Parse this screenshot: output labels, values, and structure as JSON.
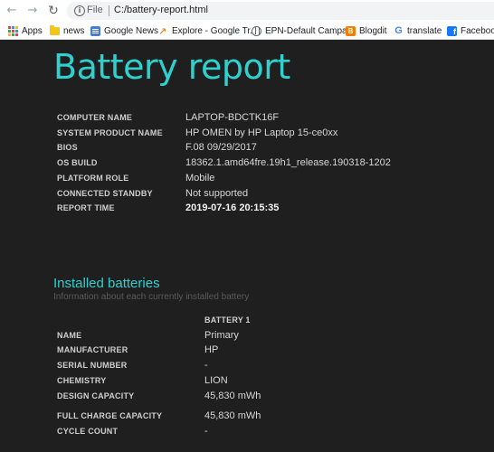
{
  "browser": {
    "nav": {
      "back": "←",
      "forward": "→",
      "reload": "↻"
    },
    "omnibox": {
      "info": "i",
      "scheme": "File",
      "url": "C:/battery-report.html"
    },
    "bookmarks": [
      "Apps",
      "news",
      "Google News",
      "Explore - Google Tr...",
      "EPN-Default Campa...",
      "Blogdit",
      "translate",
      "Facebook"
    ],
    "bookmark_icons": [
      "apps-icon",
      "folder-icon",
      "google-news-icon",
      "trends-icon",
      "globe-icon",
      "blogger-icon",
      "google-icon",
      "facebook-icon"
    ]
  },
  "report": {
    "title": "Battery report",
    "system_info": [
      {
        "label": "COMPUTER NAME",
        "value": "LAPTOP-BDCTK16F"
      },
      {
        "label": "SYSTEM PRODUCT NAME",
        "value": "HP OMEN by HP Laptop 15-ce0xx"
      },
      {
        "label": "BIOS",
        "value": "F.08 09/29/2017"
      },
      {
        "label": "OS BUILD",
        "value": "18362.1.amd64fre.19h1_release.190318-1202"
      },
      {
        "label": "PLATFORM ROLE",
        "value": "Mobile"
      },
      {
        "label": "CONNECTED STANDBY",
        "value": "Not supported"
      },
      {
        "label": "REPORT TIME",
        "value": "2019-07-16  20:15:35"
      }
    ],
    "installed": {
      "heading": "Installed batteries",
      "subtitle": "Information about each currently installed battery",
      "column": "BATTERY 1",
      "rows": [
        {
          "label": "NAME",
          "value": "Primary"
        },
        {
          "label": "MANUFACTURER",
          "value": "HP"
        },
        {
          "label": "SERIAL NUMBER",
          "value": "-"
        },
        {
          "label": "CHEMISTRY",
          "value": "LION"
        },
        {
          "label": "DESIGN CAPACITY",
          "value": "45,830 mWh"
        },
        {
          "label": "FULL CHARGE CAPACITY",
          "value": "45,830 mWh"
        },
        {
          "label": "CYCLE COUNT",
          "value": "-"
        }
      ]
    }
  },
  "colors": {
    "accent": "#2fd1cf",
    "background": "#1f1f1f"
  }
}
